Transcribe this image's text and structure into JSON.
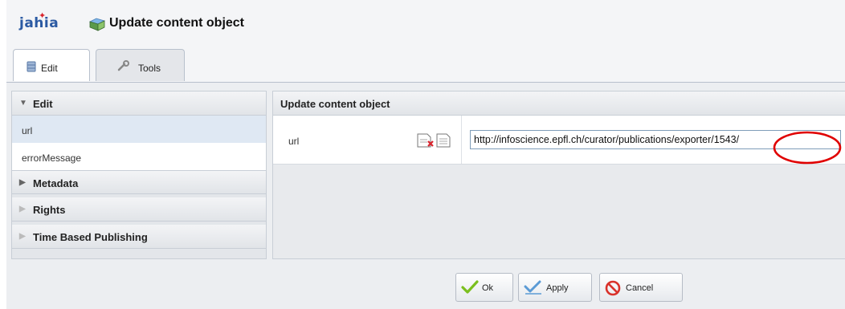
{
  "header": {
    "logo": "jahia",
    "title": "Update content object"
  },
  "tabs": [
    {
      "label": "Edit",
      "icon": "database-icon",
      "active": true
    },
    {
      "label": "Tools",
      "icon": "wrench-icon",
      "active": false
    }
  ],
  "sidebar": {
    "sections": [
      {
        "label": "Edit",
        "expanded": true,
        "items": [
          "url",
          "errorMessage"
        ]
      },
      {
        "label": "Metadata",
        "expanded": false
      },
      {
        "label": "Rights",
        "expanded": false
      },
      {
        "label": "Time Based Publishing",
        "expanded": false
      }
    ]
  },
  "main": {
    "panel_title": "Update content object",
    "field": {
      "label": "url",
      "value": "http://infoscience.epfl.ch/curator/publications/exporter/1543/"
    }
  },
  "buttons": {
    "ok": "Ok",
    "apply": "Apply",
    "cancel": "Cancel"
  },
  "colors": {
    "logo": "#2b5aa3",
    "annotation": "#e00000",
    "check": "#7bbf1e",
    "cancel_icon": "#d9322b"
  }
}
